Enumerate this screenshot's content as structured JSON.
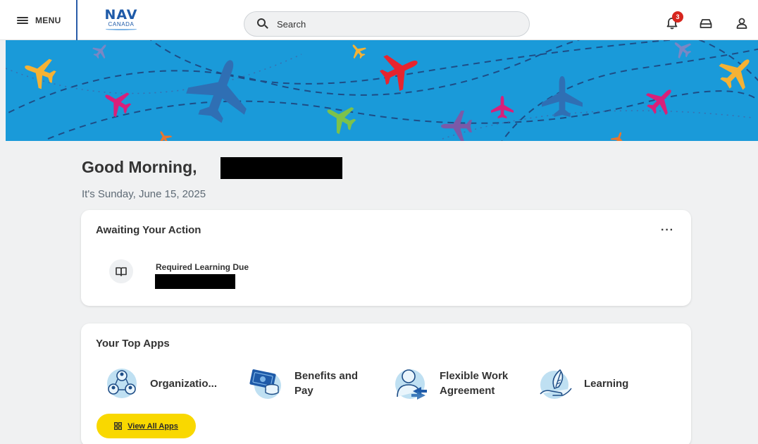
{
  "header": {
    "menu_label": "MENU",
    "logo_top": "NAV",
    "logo_bottom": "CANADA",
    "search_placeholder": "Search",
    "notification_count": "3",
    "icons": [
      "hamburger-icon",
      "search-icon",
      "bell-icon",
      "inbox-icon",
      "profile-icon"
    ]
  },
  "greeting": {
    "text": "Good Morning,",
    "date_text": "It's Sunday, June 15, 2025"
  },
  "awaiting": {
    "title": "Awaiting Your Action",
    "more_label": "···",
    "task_title": "Required Learning Due",
    "task_icon": "book-icon"
  },
  "top_apps": {
    "title": "Your Top Apps",
    "apps": [
      {
        "label_line1": "Organizatio...",
        "label_line2": "",
        "icon": "organization-icon"
      },
      {
        "label_line1": "Benefits and",
        "label_line2": "Pay",
        "icon": "benefits-pay-icon"
      },
      {
        "label_line1": "Flexible Work",
        "label_line2": "Agreement",
        "icon": "flexible-work-icon"
      },
      {
        "label_line1": "Learning",
        "label_line2": "",
        "icon": "learning-icon"
      }
    ],
    "view_all_label": "View All Apps"
  },
  "colors": {
    "banner_blue": "#1a9ad9",
    "accent_yellow": "#f9d800",
    "brand_blue": "#1e5aa8",
    "badge_red": "#d7261e"
  }
}
